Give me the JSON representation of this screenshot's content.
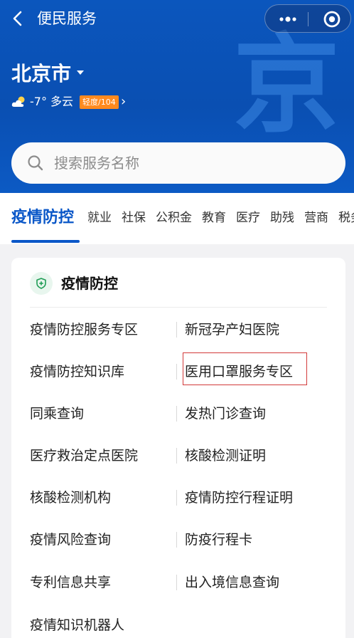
{
  "header": {
    "title": "便民服务",
    "city": "北京市",
    "weather": {
      "temperature": "-7°",
      "condition": "多云",
      "aqi_label": "轻度/104"
    },
    "background_glyph": "京"
  },
  "search": {
    "placeholder": "搜索服务名称"
  },
  "tabs": [
    {
      "label": "疫情防控",
      "active": true
    },
    {
      "label": "就业"
    },
    {
      "label": "社保"
    },
    {
      "label": "公积金"
    },
    {
      "label": "教育"
    },
    {
      "label": "医疗"
    },
    {
      "label": "助残"
    },
    {
      "label": "营商"
    },
    {
      "label": "税务"
    }
  ],
  "section": {
    "title": "疫情防控",
    "icon": "shield-plus-icon",
    "items_left": [
      "疫情防控服务专区",
      "疫情防控知识库",
      "同乘查询",
      "医疗救治定点医院",
      "核酸检测机构",
      "疫情风险查询",
      "专利信息共享",
      "疫情知识机器人"
    ],
    "items_right": [
      "新冠孕产妇医院",
      "医用口罩服务专区",
      "发热门诊查询",
      "核酸检测证明",
      "疫情防控行程证明",
      "防疫行程卡",
      "出入境信息查询"
    ]
  },
  "colors": {
    "header_blue": "#0b56bd",
    "accent_blue": "#0a57c8",
    "aqi_orange": "#ff8a1f",
    "highlight_red": "#d23a3a"
  }
}
